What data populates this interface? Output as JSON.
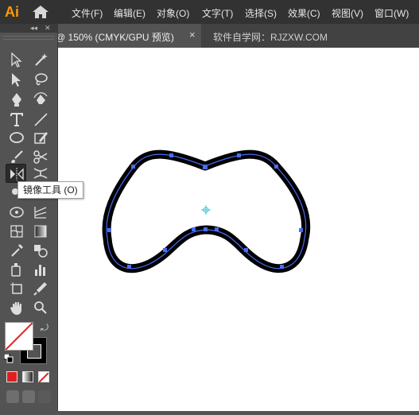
{
  "app": {
    "logo_text": "Ai"
  },
  "menu": {
    "items": [
      "文件(F)",
      "编辑(E)",
      "对象(O)",
      "文字(T)",
      "选择(S)",
      "效果(C)",
      "视图(V)",
      "窗口(W)"
    ]
  },
  "document_tab": {
    "title": "@ 150% (CMYK/GPU 预览)",
    "close_symbol": "×"
  },
  "watermark": "软件自学网：RJZXW.COM",
  "toolbar": {
    "collapse_symbol": "◂◂",
    "close_symbol": "✕",
    "tools": [
      "selection-tool",
      "direct-selection-tool",
      "magic-wand-tool",
      "lasso-tool",
      "pen-tool",
      "curvature-tool",
      "type-tool",
      "line-segment-tool",
      "ellipse-tool",
      "paintbrush-tool",
      "shaper-tool",
      "eraser-tool",
      "reflect-tool",
      "scissors-tool",
      "width-tool",
      "free-transform-tool",
      "shape-builder-tool",
      "perspective-grid-tool",
      "mesh-tool",
      "gradient-tool",
      "eyedropper-tool",
      "blend-tool",
      "symbol-sprayer-tool",
      "column-graph-tool",
      "artboard-tool",
      "slice-tool",
      "hand-tool",
      "zoom-tool"
    ],
    "selected_tool": "reflect-tool"
  },
  "tooltip": {
    "text": "镜像工具 (O)"
  },
  "colors": {
    "menubar_bg": "#323232",
    "panel_bg": "#535353",
    "canvas_bg": "#ffffff",
    "path_color": "#4a6cf7",
    "stroke_color": "#000000",
    "logo_color": "#ff9a00"
  }
}
